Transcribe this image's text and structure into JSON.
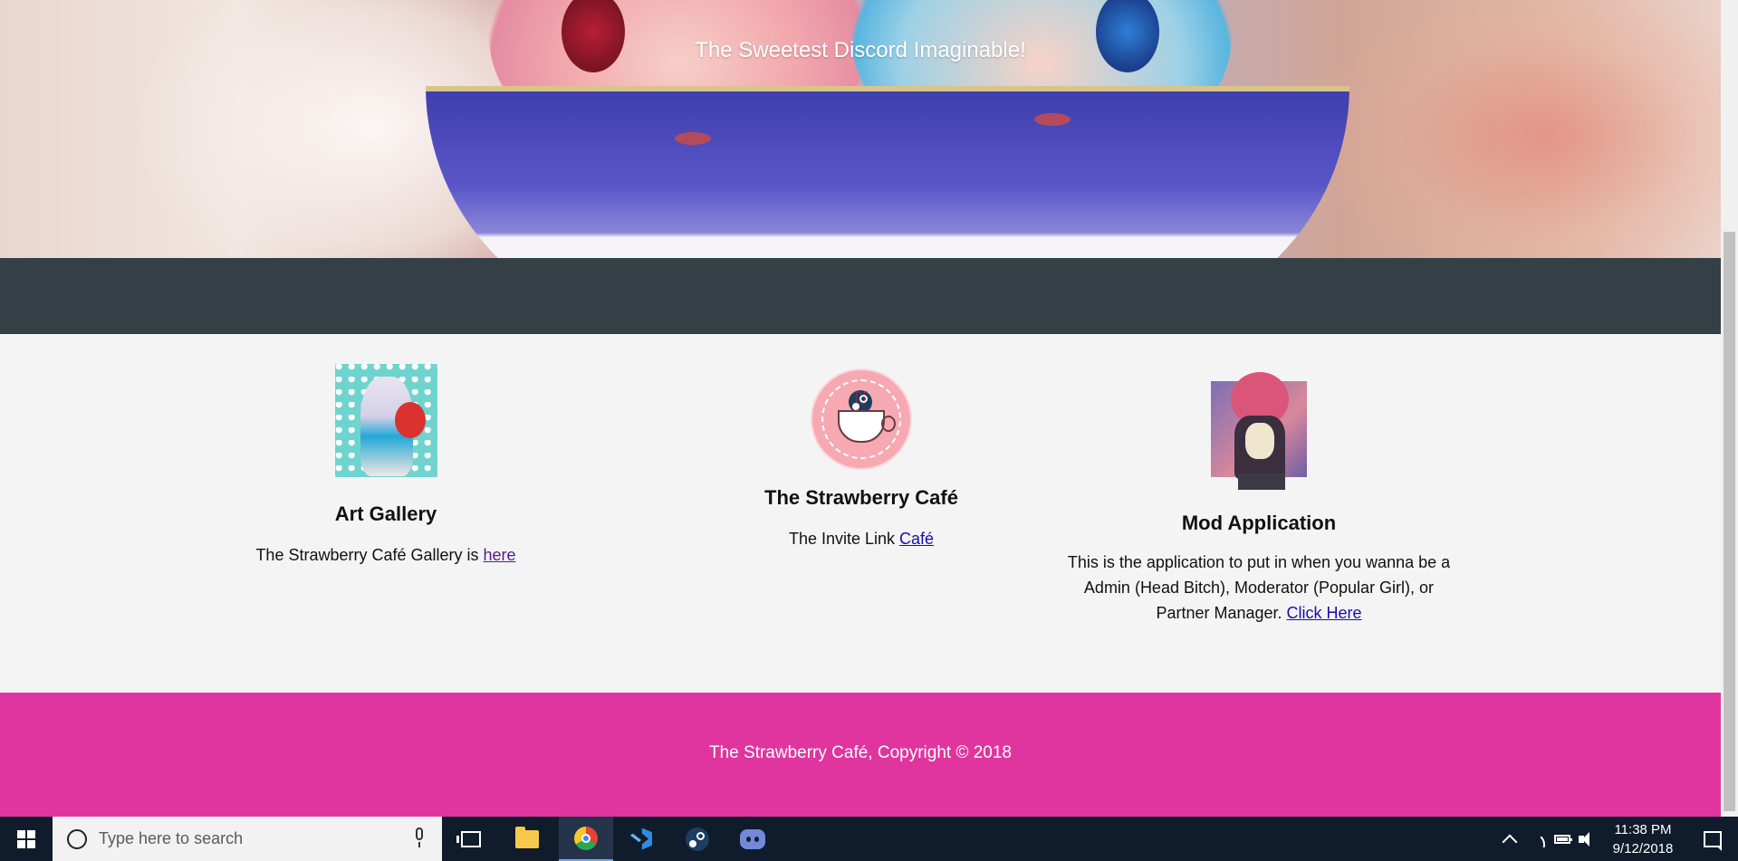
{
  "hero": {
    "title": "The Sweetest Discord Imaginable!"
  },
  "cards": [
    {
      "title": "Art Gallery",
      "text": "The Strawberry Café Gallery is ",
      "link": "here",
      "image": "art-gallery-avatar"
    },
    {
      "title": "The Strawberry Café",
      "text": "The Invite Link ",
      "link": "Café",
      "image": "strawberry-cafe-logo"
    },
    {
      "title": "Mod Application",
      "text": "This is the application to put in when you wanna be a Admin (Head Bitch), Moderator (Popular Girl), or Partner Manager. ",
      "link": "Click Here",
      "image": "mod-application-avatar"
    }
  ],
  "footer": {
    "text": "The Strawberry Café, Copyright © 2018"
  },
  "colors": {
    "band": "#343f46",
    "content_bg": "#f4f4f4",
    "footer": "#e0359f",
    "taskbar": "#101c2b"
  },
  "taskbar": {
    "search_placeholder": "Type here to search",
    "apps": [
      "task-view-icon",
      "file-explorer-icon",
      "chrome-icon",
      "vscode-icon",
      "steam-icon",
      "discord-icon"
    ],
    "active_app": "chrome-icon",
    "time": "11:38 PM",
    "date": "9/12/2018"
  }
}
